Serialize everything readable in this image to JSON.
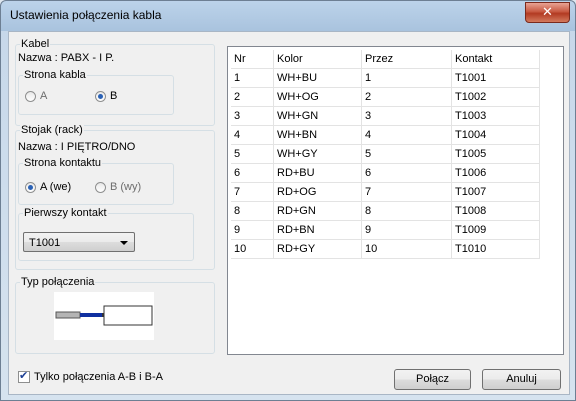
{
  "window": {
    "title": "Ustawienia połączenia kabla"
  },
  "cable": {
    "group_label": "Kabel",
    "name_text": "Nazwa : PABX - I P.",
    "side_group_label": "Strona kabla",
    "side_a_label": "A",
    "side_b_label": "B",
    "selected_side": "B"
  },
  "rack": {
    "group_label": "Stojak (rack)",
    "name_text": "Nazwa : I PIĘTRO/DNO",
    "contact_side_label": "Strona kontaktu",
    "side_a_label": "A (we)",
    "side_b_label": "B (wy)",
    "selected_side": "A (we)",
    "first_contact_label": "Pierwszy kontakt",
    "first_contact_value": "T1001"
  },
  "connection_type": {
    "group_label": "Typ połączenia"
  },
  "grid": {
    "columns": [
      "Nr",
      "Kolor",
      "Przez",
      "Kontakt"
    ],
    "rows": [
      [
        "1",
        "WH+BU",
        "1",
        "T1001"
      ],
      [
        "2",
        "WH+OG",
        "2",
        "T1002"
      ],
      [
        "3",
        "WH+GN",
        "3",
        "T1003"
      ],
      [
        "4",
        "WH+BN",
        "4",
        "T1004"
      ],
      [
        "5",
        "WH+GY",
        "5",
        "T1005"
      ],
      [
        "6",
        "RD+BU",
        "6",
        "T1006"
      ],
      [
        "7",
        "RD+OG",
        "7",
        "T1007"
      ],
      [
        "8",
        "RD+GN",
        "8",
        "T1008"
      ],
      [
        "9",
        "RD+BN",
        "9",
        "T1009"
      ],
      [
        "10",
        "RD+GY",
        "10",
        "T1010"
      ]
    ]
  },
  "footer": {
    "checkbox_label": "Tylko połączenia A-B i B-A",
    "checkbox_checked": true,
    "connect_button": "Połącz",
    "cancel_button": "Anuluj"
  }
}
